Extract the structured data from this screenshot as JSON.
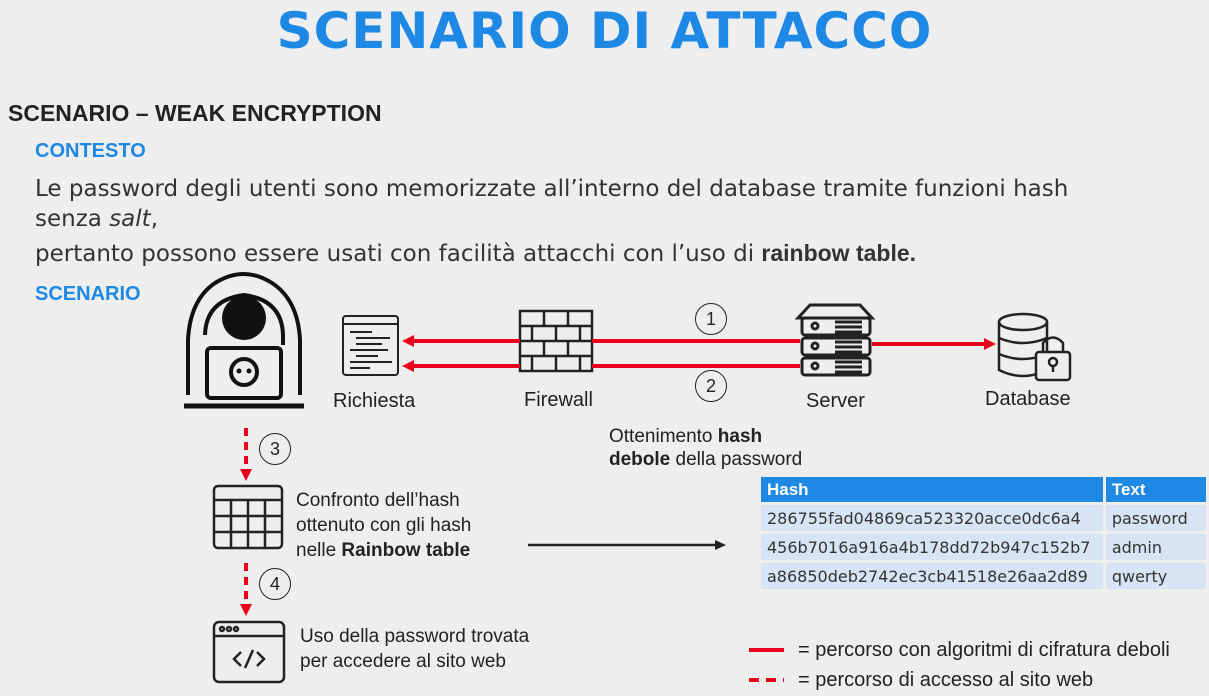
{
  "title": "SCENARIO DI ATTACCO",
  "scenario_heading": "SCENARIO – WEAK ENCRYPTION",
  "context": {
    "heading": "CONTESTO",
    "line1": "Le password degli utenti sono memorizzate all’interno del database tramite funzioni hash",
    "line2_prefix": "senza ",
    "line2_italic": "salt",
    "line2_suffix": ",",
    "line3_prefix": "pertanto possono essere usati con facilità attacchi con l’uso di ",
    "line3_bold": "rainbow table."
  },
  "scenario": {
    "heading": "SCENARIO",
    "nodes": {
      "richiesta": "Richiesta",
      "firewall": "Firewall",
      "server": "Server",
      "database": "Database"
    },
    "steps": [
      "1",
      "2",
      "3",
      "4"
    ],
    "obtain_hash": {
      "prefix": "Ottenimento ",
      "bold1": "hash",
      "bold2": "debole",
      "suffix": " della password"
    },
    "compare": {
      "line1": "Confronto dell’hash",
      "line2": "ottenuto con gli hash",
      "line3_prefix": "nelle ",
      "line3_bold": "Rainbow table"
    },
    "use_password": {
      "line1": "Uso della password trovata",
      "line2": "per accedere al sito web"
    }
  },
  "rainbow_table": {
    "headers": [
      "Hash",
      "Text"
    ],
    "rows": [
      [
        "286755fad04869ca523320acce0dc6a4",
        "password"
      ],
      [
        "456b7016a916a4b178dd72b947c152b7",
        "admin"
      ],
      [
        "a86850deb2742ec3cb41518e26aa2d89",
        "qwerty"
      ]
    ]
  },
  "legend": {
    "solid": "= percorso con algoritmi di cifratura deboli",
    "dashed": "= percorso di accesso al sito web"
  },
  "colors": {
    "accent_blue": "#1e88e5",
    "path_red": "#e8001c",
    "table_row_bg": "#d6e4f5"
  }
}
